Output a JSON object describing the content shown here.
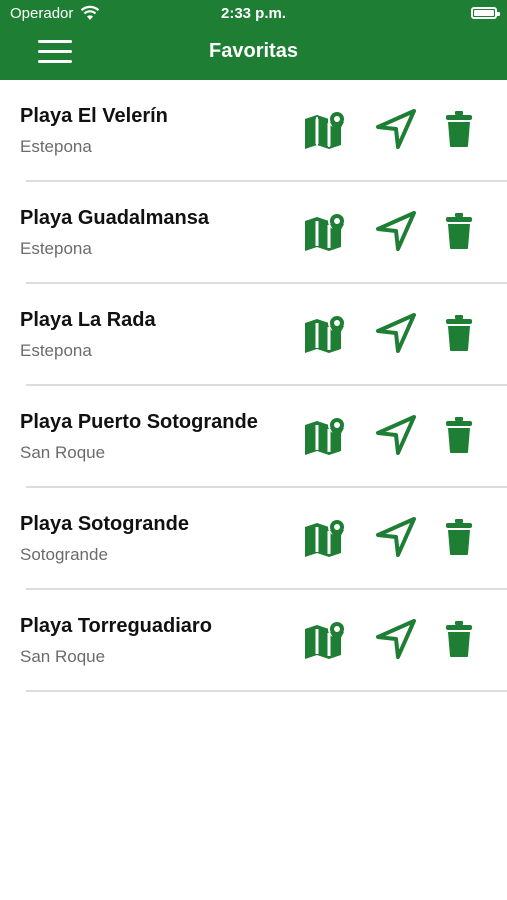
{
  "status_bar": {
    "carrier": "Operador",
    "time": "2:33 p.m."
  },
  "header": {
    "title": "Favoritas"
  },
  "favorites": [
    {
      "name": "Playa El Velerín",
      "location": "Estepona"
    },
    {
      "name": "Playa Guadalmansa",
      "location": "Estepona"
    },
    {
      "name": "Playa La Rada",
      "location": "Estepona"
    },
    {
      "name": "Playa Puerto Sotogrande",
      "location": "San Roque"
    },
    {
      "name": "Playa Sotogrande",
      "location": "Sotogrande"
    },
    {
      "name": "Playa Torreguadiaro",
      "location": "San Roque"
    }
  ],
  "row_icons": [
    "map-pin-icon",
    "navigation-arrow-icon",
    "trash-icon"
  ],
  "colors": {
    "brand_green": "#1e7e34",
    "icon_green": "#1e7e34",
    "divider": "#dcdcdc"
  }
}
